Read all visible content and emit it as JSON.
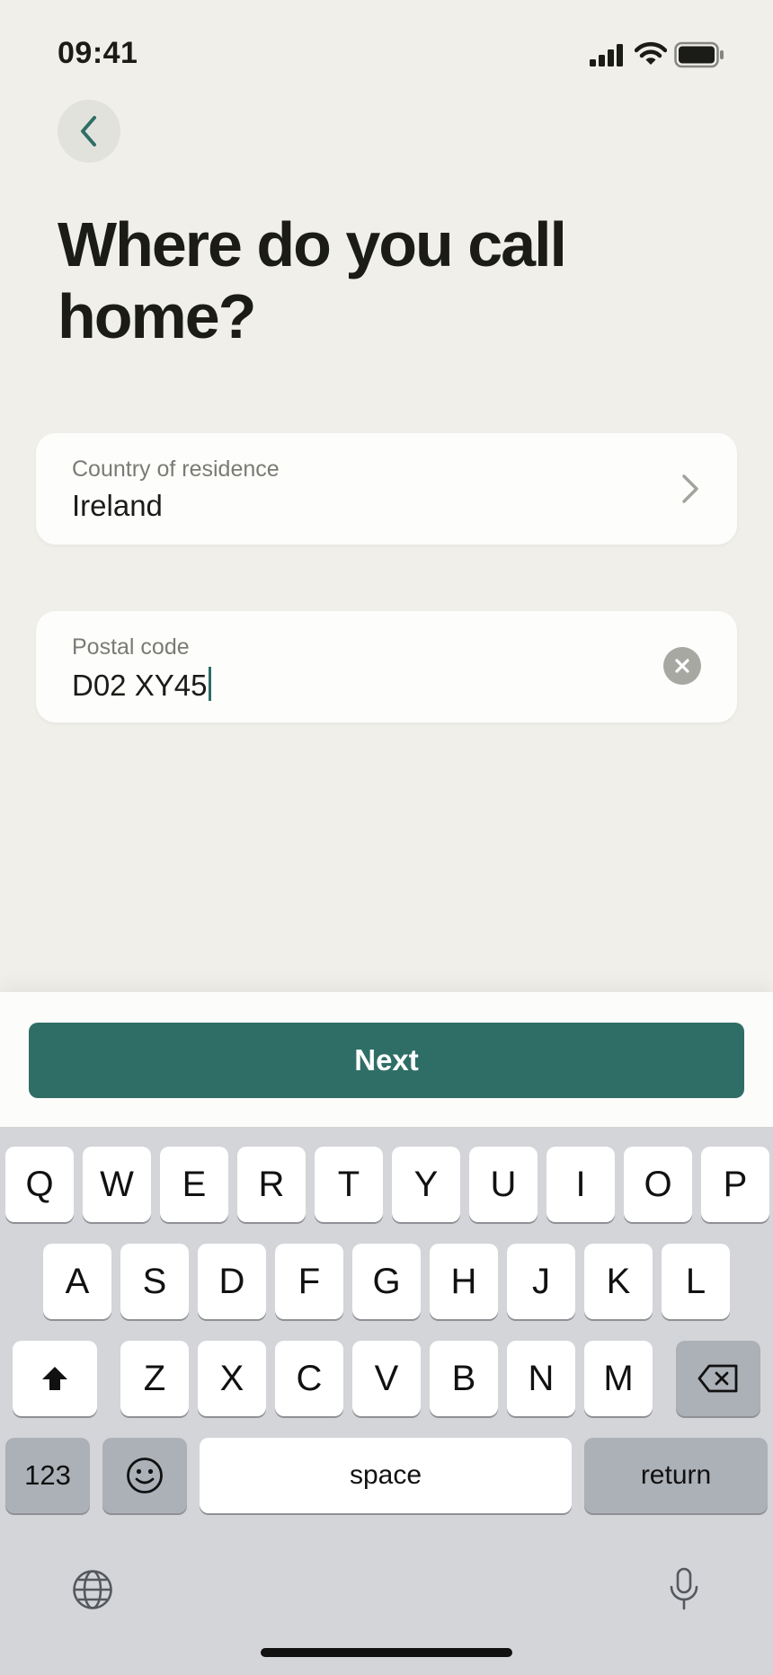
{
  "status_bar": {
    "time": "09:41"
  },
  "header": {
    "title": "Where do you call home?"
  },
  "fields": {
    "country": {
      "label": "Country of residence",
      "value": "Ireland"
    },
    "postal": {
      "label": "Postal code",
      "value": "D02 XY45"
    }
  },
  "actions": {
    "next_label": "Next"
  },
  "keyboard": {
    "row1": [
      "Q",
      "W",
      "E",
      "R",
      "T",
      "Y",
      "U",
      "I",
      "O",
      "P"
    ],
    "row2": [
      "A",
      "S",
      "D",
      "F",
      "G",
      "H",
      "J",
      "K",
      "L"
    ],
    "row3": [
      "Z",
      "X",
      "C",
      "V",
      "B",
      "N",
      "M"
    ],
    "numbers_label": "123",
    "space_label": "space",
    "return_label": "return"
  },
  "colors": {
    "accent": "#2f6e66",
    "background": "#f0efea",
    "field": "#fdfdfb",
    "keyboard": "#d3d5d9"
  }
}
